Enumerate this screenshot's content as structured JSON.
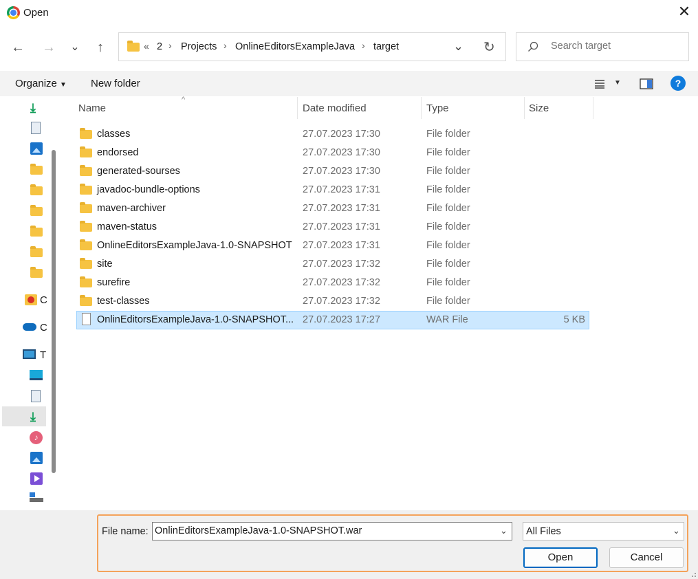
{
  "window": {
    "title": "Open",
    "close": "✕"
  },
  "nav": {
    "back": "←",
    "forward": "→",
    "history": "⌄",
    "up": "↑"
  },
  "address": {
    "overflow": "«",
    "crumbs": [
      "2",
      "Projects",
      "OnlineEditorsExampleJava",
      "target"
    ],
    "separator": "›",
    "dropdown": "⌄",
    "refresh": "↻"
  },
  "search": {
    "placeholder": "Search target"
  },
  "toolbar": {
    "organize": "Organize",
    "new_folder": "New folder",
    "help": "?"
  },
  "sidebar": {
    "items": [
      {
        "icon": "download-icon"
      },
      {
        "icon": "document-icon"
      },
      {
        "icon": "pictures-icon"
      },
      {
        "icon": "folder-icon"
      },
      {
        "icon": "folder-icon"
      },
      {
        "icon": "folder-icon"
      },
      {
        "icon": "folder-icon"
      },
      {
        "icon": "folder-icon"
      },
      {
        "icon": "folder-icon"
      },
      {
        "icon": "creative-cloud-icon",
        "label": "C"
      },
      {
        "icon": "onedrive-icon",
        "label": "C"
      },
      {
        "icon": "this-pc-icon",
        "label": "T"
      },
      {
        "icon": "desktop-icon"
      },
      {
        "icon": "document-icon"
      },
      {
        "icon": "download-icon"
      },
      {
        "icon": "music-icon"
      },
      {
        "icon": "pictures-icon"
      },
      {
        "icon": "videos-icon"
      },
      {
        "icon": "drive-icon"
      }
    ]
  },
  "columns": {
    "name": "Name",
    "date": "Date modified",
    "type": "Type",
    "size": "Size"
  },
  "files": [
    {
      "name": "classes",
      "date": "27.07.2023 17:30",
      "type": "File folder",
      "size": ""
    },
    {
      "name": "endorsed",
      "date": "27.07.2023 17:30",
      "type": "File folder",
      "size": ""
    },
    {
      "name": "generated-sourses",
      "date": "27.07.2023 17:30",
      "type": "File folder",
      "size": ""
    },
    {
      "name": "javadoc-bundle-options",
      "date": "27.07.2023 17:31",
      "type": "File folder",
      "size": ""
    },
    {
      "name": "maven-archiver",
      "date": "27.07.2023 17:31",
      "type": "File folder",
      "size": ""
    },
    {
      "name": "maven-status",
      "date": "27.07.2023 17:31",
      "type": "File folder",
      "size": ""
    },
    {
      "name": "OnlineEditorsExampleJava-1.0-SNAPSHOT",
      "date": "27.07.2023 17:31",
      "type": "File folder",
      "size": ""
    },
    {
      "name": "site",
      "date": "27.07.2023 17:32",
      "type": "File folder",
      "size": ""
    },
    {
      "name": "surefire",
      "date": "27.07.2023 17:32",
      "type": "File folder",
      "size": ""
    },
    {
      "name": "test-classes",
      "date": "27.07.2023 17:32",
      "type": "File folder",
      "size": ""
    },
    {
      "name": "OnlinEditorsExampleJava-1.0-SNAPSHOT...",
      "date": "27.07.2023 17:27",
      "type": "WAR File",
      "size": "5 KB"
    }
  ],
  "footer": {
    "filename_label": "File name:",
    "filename_value": "OnlinEditorsExampleJava-1.0-SNAPSHOT.war",
    "filter_value": "All Files",
    "open": "Open",
    "cancel": "Cancel"
  },
  "colors": {
    "accent": "#0067c0",
    "selection": "#cce8ff",
    "highlight_frame": "#f4a25a",
    "folder": "#f6c342"
  }
}
